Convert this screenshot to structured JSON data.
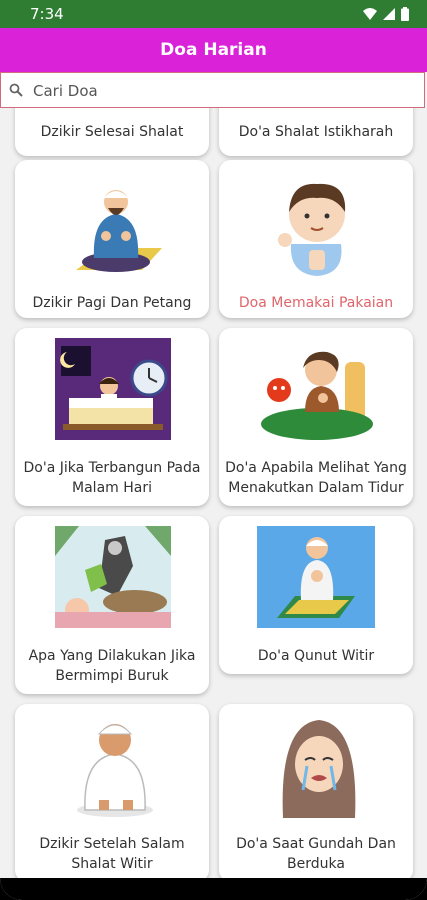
{
  "status": {
    "time": "7:34"
  },
  "appbar": {
    "title": "Doa Harian"
  },
  "search": {
    "placeholder": "Cari Doa"
  },
  "cards": [
    {
      "label": "Dzikir Selesai Shalat",
      "icon": "praying-man-image"
    },
    {
      "label": "Do'a Shalat Istikharah",
      "icon": "praying-image"
    },
    {
      "label": "Dzikir Pagi Dan Petang",
      "icon": "man-sitting-praying-image"
    },
    {
      "label": "Doa Memakai Pakaian",
      "icon": "boy-dressing-image"
    },
    {
      "label": "Do'a Jika Terbangun Pada Malam Hari",
      "icon": "waking-night-image"
    },
    {
      "label": "Do'a Apabila Melihat Yang Menakutkan Dalam Tidur",
      "icon": "boy-frightened-image"
    },
    {
      "label": "Apa Yang Dilakukan Jika Bermimpi Buruk",
      "icon": "bad-dream-image"
    },
    {
      "label": "Do'a Qunut Witir",
      "icon": "boy-praying-on-mat-image"
    },
    {
      "label": "Dzikir Setelah Salam Shalat Witir",
      "icon": "man-sitting-back-image"
    },
    {
      "label": "Do'a Saat Gundah Dan Berduka",
      "icon": "crying-woman-image"
    }
  ],
  "colors": {
    "status_bar": "#2e7d32",
    "app_bar": "#da22d9",
    "highlight_label": "#e0656b"
  }
}
